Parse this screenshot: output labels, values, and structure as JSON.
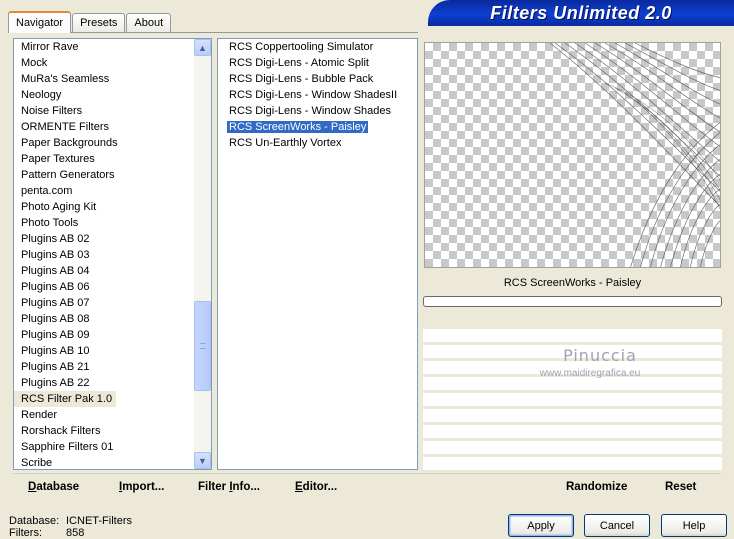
{
  "tabs": [
    {
      "label": "Navigator",
      "active": true
    },
    {
      "label": "Presets",
      "active": false
    },
    {
      "label": "About",
      "active": false
    }
  ],
  "banner": {
    "title": "Filters Unlimited 2.0",
    "color": "#0d3fd0"
  },
  "categories": {
    "items": [
      "Mirror Rave",
      "Mock",
      "MuRa's Seamless",
      "Neology",
      "Noise Filters",
      "ORMENTE Filters",
      "Paper Backgrounds",
      "Paper Textures",
      "Pattern Generators",
      "penta.com",
      "Photo Aging Kit",
      "Photo Tools",
      "Plugins AB 02",
      "Plugins AB 03",
      "Plugins AB 04",
      "Plugins AB 06",
      "Plugins AB 07",
      "Plugins AB 08",
      "Plugins AB 09",
      "Plugins AB 10",
      "Plugins AB 21",
      "Plugins AB 22",
      "RCS Filter Pak 1.0",
      "Render",
      "Rorshack Filters",
      "Sapphire Filters 01",
      "Scribe"
    ],
    "selected": "RCS Filter Pak 1.0",
    "scroll_up_icon": "arrow-up-icon",
    "scroll_down_icon": "arrow-down-icon"
  },
  "filters": {
    "items": [
      "RCS Coppertooling Simulator",
      "RCS Digi-Lens - Atomic Split",
      "RCS Digi-Lens - Bubble Pack",
      "RCS Digi-Lens - Window ShadesII",
      "RCS Digi-Lens - Window Shades",
      "RCS ScreenWorks - Paisley",
      "RCS Un-Earthly Vortex"
    ],
    "selected": "RCS ScreenWorks - Paisley",
    "selection_color": "#316ac5"
  },
  "preview": {
    "filter_name": "RCS ScreenWorks - Paisley",
    "progress": 0
  },
  "watermark": {
    "name": "Pinuccia",
    "url": "www.maidiregrafica.eu"
  },
  "toolbar": {
    "database_first": "D",
    "database_rest": "atabase",
    "import_first": "I",
    "import_rest": "mport...",
    "filterinfo_pre": "Filter ",
    "filterinfo_u": "I",
    "filterinfo_post": "nfo...",
    "editor_first": "E",
    "editor_rest": "ditor...",
    "randomize": "Randomize",
    "reset": "Reset"
  },
  "status": {
    "database_label": "Database:",
    "database_value": "ICNET-Filters",
    "filters_label": "Filters:",
    "filters_value": "858"
  },
  "buttons": {
    "apply": "Apply",
    "cancel": "Cancel",
    "help": "Help"
  }
}
